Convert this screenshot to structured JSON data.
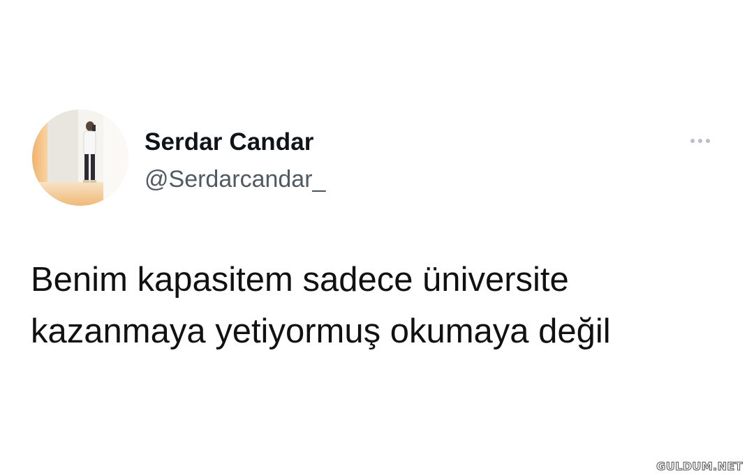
{
  "tweet": {
    "author": {
      "name": "Serdar Candar",
      "handle": "@Serdarcandar_",
      "avatar_icon": "profile-photo"
    },
    "more_icon": "more-horizontal-icon",
    "text_lines": [
      "Benim kapasitem sadece üniversite",
      "kazanmaya yetiyormuş okumaya değil"
    ]
  },
  "watermark": {
    "text": "GULDUM.NET"
  },
  "colors": {
    "background": "#ffffff",
    "name_text": "#0f1419",
    "handle_text": "#4f5a63",
    "more_dots": "#b8bfc6"
  }
}
